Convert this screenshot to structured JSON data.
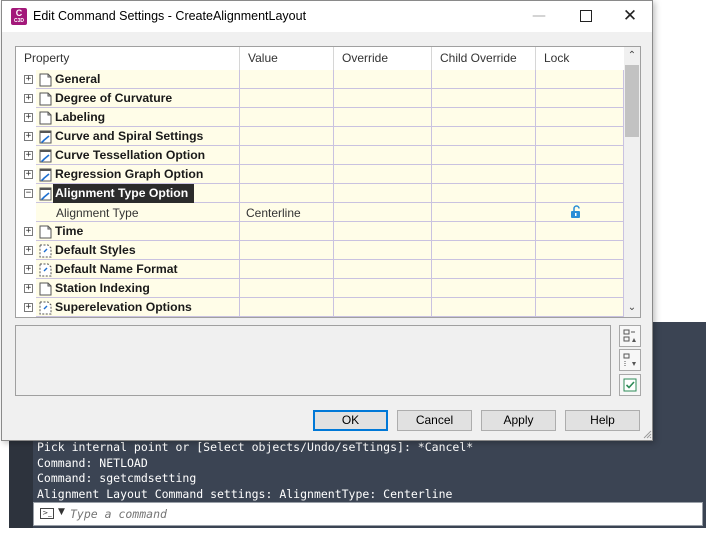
{
  "dialog": {
    "title": "Edit Command Settings - CreateAlignmentLayout",
    "app_icon_letter": "C",
    "app_icon_sub": "C3D"
  },
  "grid": {
    "headers": [
      "Property",
      "Value",
      "Override",
      "Child Override",
      "Lock"
    ],
    "rows": [
      {
        "label": "General",
        "expand": "+",
        "icon": "page"
      },
      {
        "label": "Degree of Curvature",
        "expand": "+",
        "icon": "page"
      },
      {
        "label": "Labeling",
        "expand": "+",
        "icon": "page"
      },
      {
        "label": "Curve and Spiral Settings",
        "expand": "+",
        "icon": "page-arrow"
      },
      {
        "label": "Curve Tessellation Option",
        "expand": "+",
        "icon": "page-arrow"
      },
      {
        "label": "Regression Graph Option",
        "expand": "+",
        "icon": "page-arrow"
      },
      {
        "label": "Alignment Type Option",
        "expand": "−",
        "icon": "page-arrow",
        "selected": true
      },
      {
        "label": "Alignment Type",
        "value": "Centerline",
        "child": true,
        "lock_icon": "unlock-icon"
      },
      {
        "label": "Time",
        "expand": "+",
        "icon": "page"
      },
      {
        "label": "Default Styles",
        "expand": "+",
        "icon": "dashed-page"
      },
      {
        "label": "Default Name Format",
        "expand": "+",
        "icon": "dashed-page"
      },
      {
        "label": "Station Indexing",
        "expand": "+",
        "icon": "page"
      },
      {
        "label": "Superelevation Options",
        "expand": "+",
        "icon": "dashed-page"
      }
    ]
  },
  "buttons": {
    "ok": "OK",
    "cancel": "Cancel",
    "apply": "Apply",
    "help": "Help"
  },
  "command_line": {
    "history": [
      "Pick internal point or [Select objects/Undo/seTtings]: *Cancel*",
      "Command: NETLOAD",
      "Command: sgetcmdsetting",
      "Alignment Layout Command settings: AlignmentType: Centerline"
    ],
    "placeholder": "Type a command"
  },
  "colors": {
    "row_bg": "#fffde8",
    "grid_lines": "#c9c2e0",
    "selected_bg": "#2b2b2b",
    "accent": "#0078d7",
    "app_icon": "#a3187a",
    "lock_icon": "#2a8fd6",
    "cmd_bg": "#3b4453"
  }
}
